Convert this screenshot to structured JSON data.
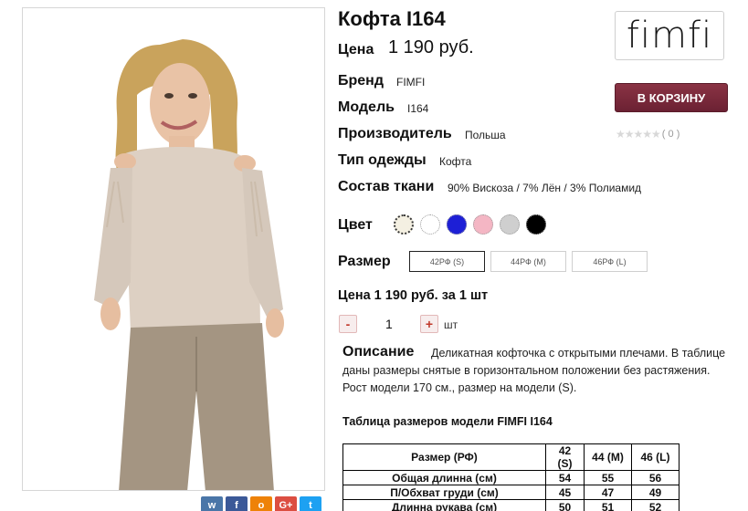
{
  "product": {
    "title": "Кофта I164",
    "price_label": "Цена",
    "price_value": "1 190 руб.",
    "attributes": [
      {
        "label": "Бренд",
        "value": "FIMFI"
      },
      {
        "label": "Модель",
        "value": "I164"
      },
      {
        "label": "Производитель",
        "value": "Польша"
      },
      {
        "label": "Тип одежды",
        "value": "Кофта"
      },
      {
        "label": "Состав ткани",
        "value": "90% Вискоза / 7% Лён / 3% Полиамид"
      }
    ],
    "color_label": "Цвет",
    "colors": [
      {
        "name": "ecru",
        "hex": "#f4f0e2",
        "selected": true
      },
      {
        "name": "white",
        "hex": "#ffffff",
        "selected": false
      },
      {
        "name": "blue",
        "hex": "#1d1fd6",
        "selected": false
      },
      {
        "name": "pink",
        "hex": "#f4b6c4",
        "selected": false
      },
      {
        "name": "grey",
        "hex": "#cfcfcf",
        "selected": false
      },
      {
        "name": "black",
        "hex": "#000000",
        "selected": false
      }
    ],
    "size_label": "Размер",
    "sizes": [
      {
        "label": "42РФ (S)",
        "selected": true
      },
      {
        "label": "44РФ (M)",
        "selected": false
      },
      {
        "label": "46РФ (L)",
        "selected": false
      }
    ],
    "unit_price_line": "Цена 1 190 руб. за 1 шт",
    "quantity": {
      "minus": "-",
      "value": "1",
      "plus": "+",
      "unit": "шт"
    },
    "description_label": "Описание",
    "description_text": "Деликатная кофточка с открытыми плечами. В таблице даны размеры снятые в горизонтальном положении без растяжения. Рост модели 170 см., размер на модели (S)."
  },
  "brand": {
    "logo_text": "fimfi"
  },
  "cart": {
    "button_label": "В КОРЗИНУ"
  },
  "rating": {
    "stars": "★★★★★",
    "count": "( 0 )"
  },
  "size_table": {
    "title": "Таблица размеров модели FIMFI  I164",
    "header": [
      "Размер (РФ)",
      "42 (S)",
      "44 (M)",
      "46 (L)"
    ],
    "rows": [
      [
        "Общая длинна (см)",
        "54",
        "55",
        "56"
      ],
      [
        "П/Обхват груди (см)",
        "45",
        "47",
        "49"
      ],
      [
        "Длинна рукава (см)",
        "50",
        "51",
        "52"
      ]
    ]
  },
  "share": [
    {
      "icon": "vk-icon",
      "glyph": "w",
      "color": "#4a76a8"
    },
    {
      "icon": "facebook-icon",
      "glyph": "f",
      "color": "#3b5998"
    },
    {
      "icon": "odnoklassniki-icon",
      "glyph": "о",
      "color": "#ee8208"
    },
    {
      "icon": "google-plus-icon",
      "glyph": "G+",
      "color": "#dc4e41"
    },
    {
      "icon": "twitter-icon",
      "glyph": "t",
      "color": "#1da1f2"
    }
  ]
}
